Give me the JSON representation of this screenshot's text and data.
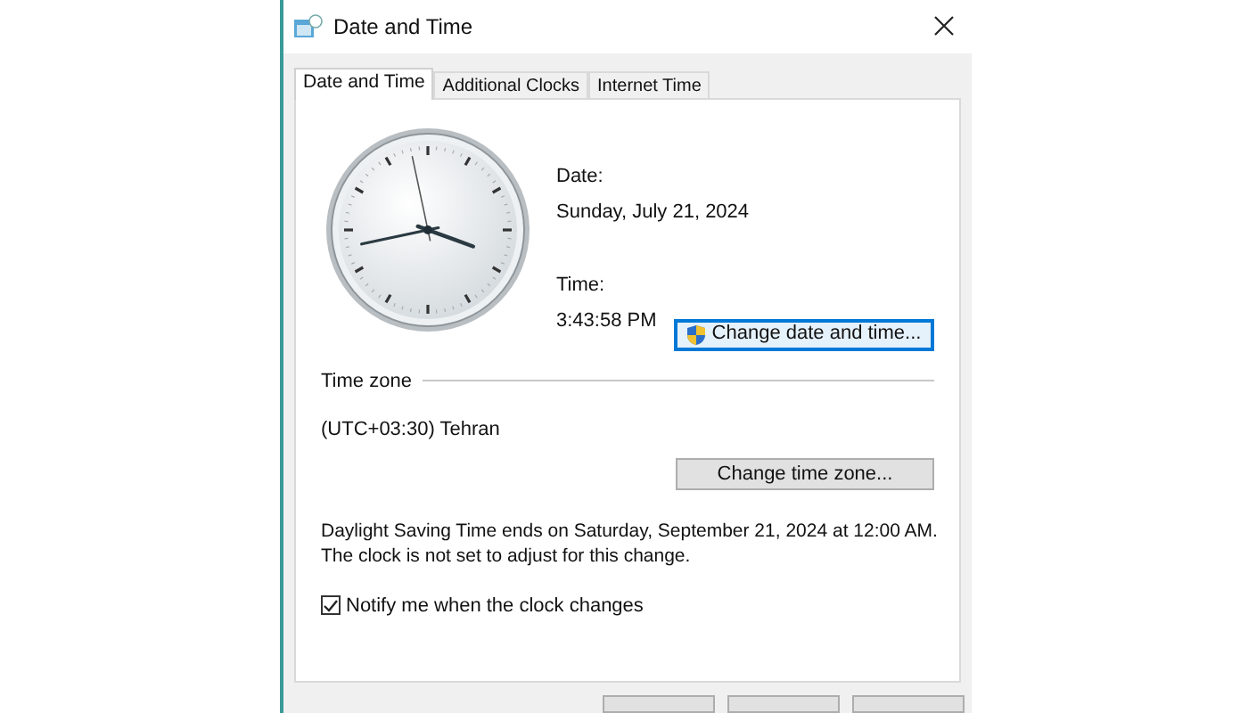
{
  "window": {
    "title": "Date and Time"
  },
  "tabs": [
    {
      "label": "Date and Time",
      "selected": true
    },
    {
      "label": "Additional Clocks",
      "selected": false
    },
    {
      "label": "Internet Time",
      "selected": false
    }
  ],
  "date": {
    "label": "Date:",
    "value": "Sunday, July 21, 2024"
  },
  "time": {
    "label": "Time:",
    "value": "3:43:58 PM"
  },
  "change_date_button": {
    "label": "Change date and time...",
    "focused": true
  },
  "time_zone": {
    "heading": "Time zone",
    "value": "(UTC+03:30) Tehran",
    "button": "Change time zone..."
  },
  "dst_notice": [
    "Daylight Saving Time ends on Saturday, September 21, 2024 at 12:00 AM.",
    "The clock is not set to adjust for this change."
  ],
  "notify": {
    "label": "Notify me when the clock changes",
    "checked": true
  }
}
